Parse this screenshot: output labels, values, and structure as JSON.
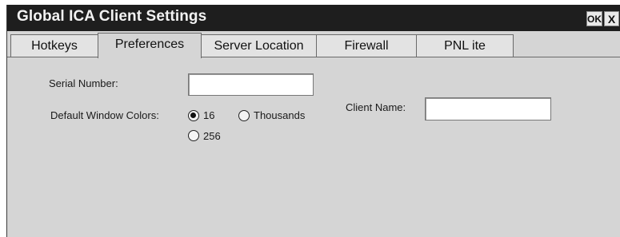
{
  "window": {
    "title": "Global ICA Client Settings",
    "ok_label": "OK",
    "close_label": "X"
  },
  "tabs": [
    {
      "label": "Hotkeys",
      "active": false
    },
    {
      "label": "Preferences",
      "active": true
    },
    {
      "label": "Server Location",
      "active": false
    },
    {
      "label": "Firewall",
      "active": false
    },
    {
      "label": "PNL ite",
      "active": false
    }
  ],
  "preferences": {
    "serial_number_label": "Serial Number:",
    "serial_number_value": "",
    "colors_label": "Default Window Colors:",
    "color_options": [
      {
        "label": "16",
        "selected": true
      },
      {
        "label": "Thousands",
        "selected": false
      },
      {
        "label": "256",
        "selected": false
      }
    ],
    "client_name_label": "Client Name:",
    "client_name_value": ""
  }
}
